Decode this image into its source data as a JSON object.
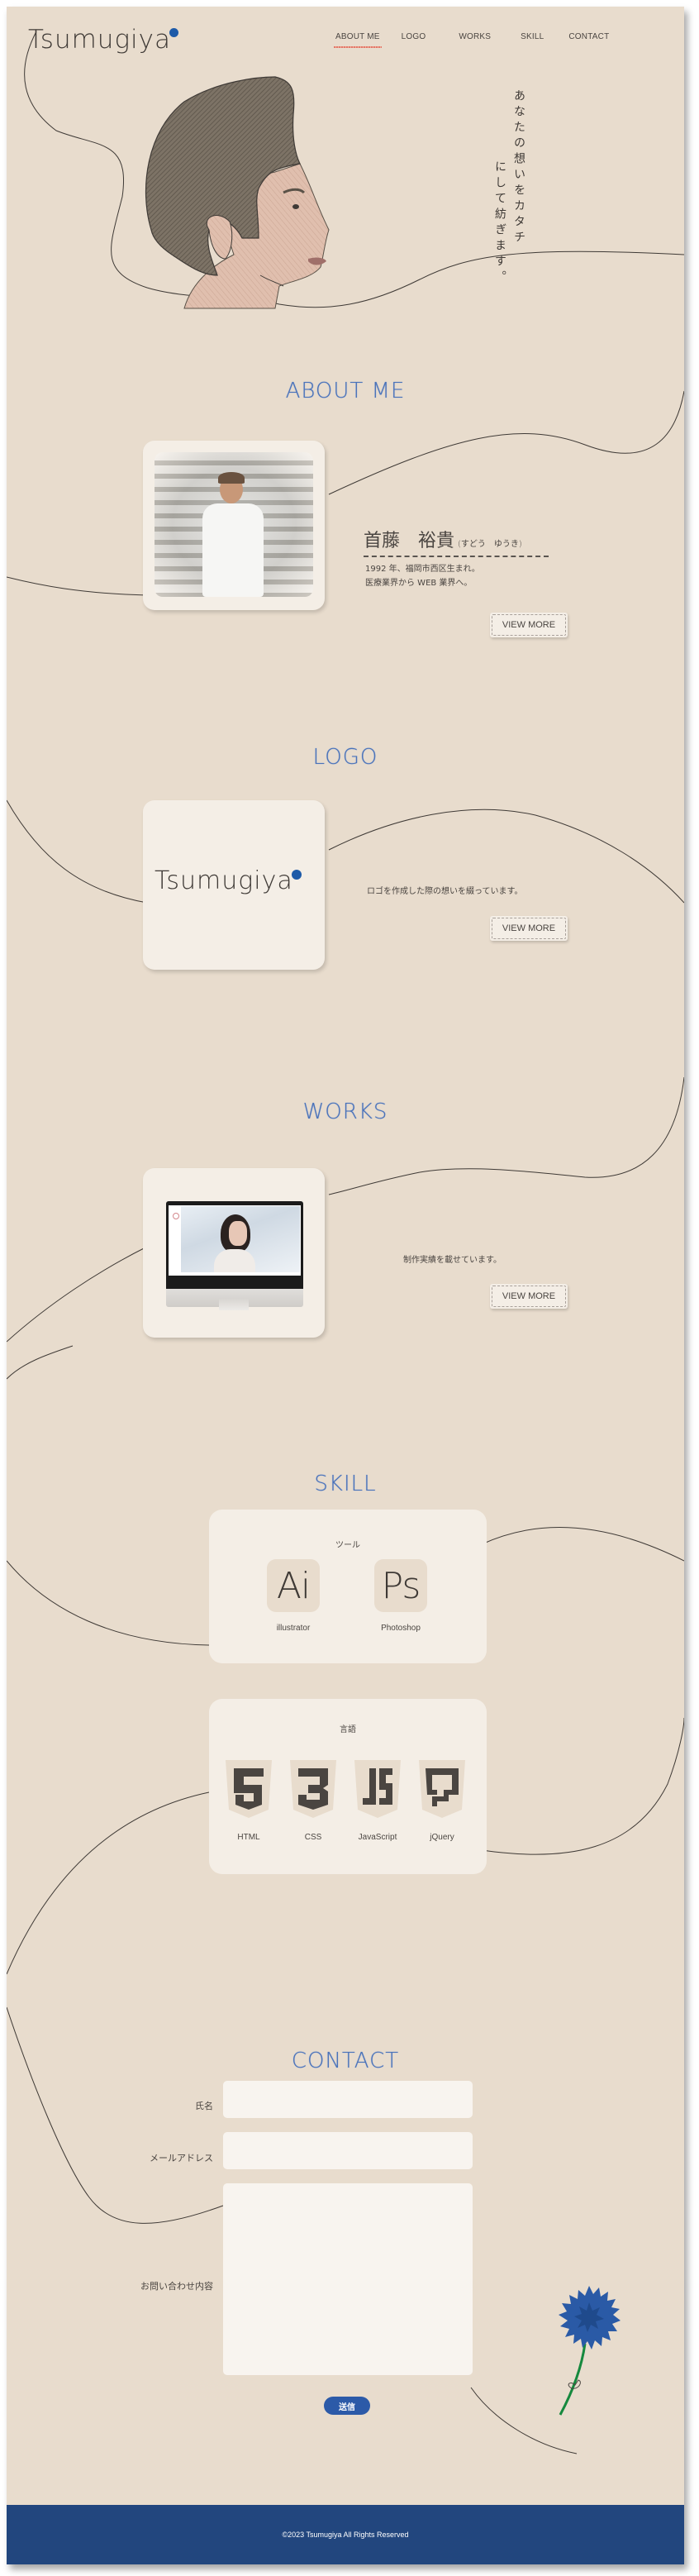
{
  "header": {
    "logo": "Tsumugiya",
    "nav": [
      {
        "label": "ABOUT ME",
        "active": true
      },
      {
        "label": "LOGO",
        "active": false
      },
      {
        "label": "WORKS",
        "active": false
      },
      {
        "label": "SKILL",
        "active": false
      },
      {
        "label": "CONTACT",
        "active": false
      }
    ]
  },
  "hero": {
    "catch_line1": "あなたの想いをカタチ",
    "catch_line2": "にして紡ぎます。",
    "illustration": "sketched-profile-portrait"
  },
  "about": {
    "title": "ABOUT ME",
    "photo": "profile-photo",
    "name": "首藤　裕貴",
    "name_kana": "(すどう　ゆうき)",
    "line1": "1992 年、福岡市西区生まれ。",
    "line2": "医療業界から WEB 業界へ。",
    "button": "VIEW MORE"
  },
  "logo_section": {
    "title": "LOGO",
    "logo_text": "Tsumugiya",
    "description": "ロゴを作成した際の想いを綴っています。",
    "button": "VIEW MORE"
  },
  "works": {
    "title": "WORKS",
    "image": "monitor-mockup",
    "description": "制作実績を載せています。",
    "button": "VIEW MORE"
  },
  "skill": {
    "title": "SKILL",
    "tools": {
      "heading": "ツール",
      "items": [
        {
          "icon": "Ai",
          "label": "illustrator"
        },
        {
          "icon": "Ps",
          "label": "Photoshop"
        }
      ]
    },
    "languages": {
      "heading": "言語",
      "items": [
        {
          "icon": "html5-icon",
          "label": "HTML"
        },
        {
          "icon": "css3-icon",
          "label": "CSS"
        },
        {
          "icon": "javascript-icon",
          "label": "JavaScript"
        },
        {
          "icon": "jquery-icon",
          "label": "jQuery"
        }
      ]
    }
  },
  "contact": {
    "title": "CONTACT",
    "fields": [
      {
        "label": "氏名",
        "value": "",
        "placeholder": ""
      },
      {
        "label": "メールアドレス",
        "value": "",
        "placeholder": ""
      },
      {
        "label": "お問い合わせ内容",
        "value": "",
        "placeholder": ""
      }
    ],
    "submit": "送信"
  },
  "footer": {
    "copyright": "©2023 Tsumugiya All Rights Reserved"
  },
  "colors": {
    "background": "#e8dccd",
    "card": "#f4eee6",
    "accent_blue": "#2c5aa8",
    "title_blue": "#4a72b8",
    "footer": "#22467e",
    "nav_underline": "#e27868",
    "text": "#4a4541"
  }
}
